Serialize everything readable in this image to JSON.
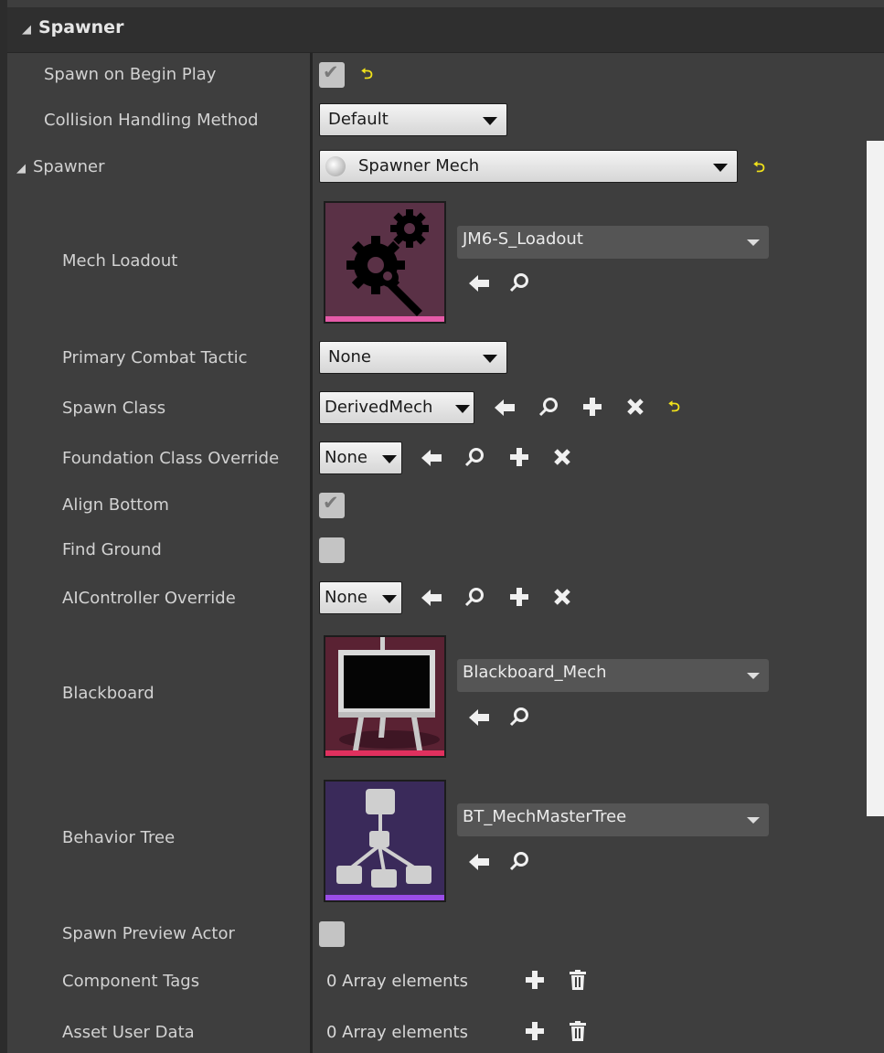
{
  "category": {
    "title": "Spawner"
  },
  "rows": {
    "spawn_on_begin_play": {
      "label": "Spawn on Begin Play",
      "checked": true
    },
    "collision_handling": {
      "label": "Collision Handling Method",
      "value": "Default"
    },
    "spawner": {
      "label": "Spawner",
      "value": "Spawner Mech"
    },
    "mech_loadout": {
      "label": "Mech Loadout",
      "asset": "JM6-S_Loadout"
    },
    "primary_combat_tactic": {
      "label": "Primary Combat Tactic",
      "value": "None"
    },
    "spawn_class": {
      "label": "Spawn Class",
      "value": "DerivedMech"
    },
    "foundation_class_override": {
      "label": "Foundation Class Override",
      "value": "None"
    },
    "align_bottom": {
      "label": "Align Bottom",
      "checked": true
    },
    "find_ground": {
      "label": "Find Ground",
      "checked": false
    },
    "aicontroller_override": {
      "label": "AIController Override",
      "value": "None"
    },
    "blackboard": {
      "label": "Blackboard",
      "asset": "Blackboard_Mech"
    },
    "behavior_tree": {
      "label": "Behavior Tree",
      "asset": "BT_MechMasterTree"
    },
    "spawn_preview_actor": {
      "label": "Spawn Preview Actor",
      "checked": false
    },
    "component_tags": {
      "label": "Component Tags",
      "value": "0 Array elements"
    },
    "asset_user_data": {
      "label": "Asset User Data",
      "value": "0 Array elements"
    }
  },
  "icons": {
    "reset": "reset-to-default-icon",
    "use_selected": "left-arrow-icon",
    "browse": "search-icon",
    "add": "plus-icon",
    "clear": "x-icon",
    "delete": "trash-icon"
  },
  "colors": {
    "reset_arrow": "#f1e21a",
    "loadout_bar": "#e55aa8",
    "blackboard_bar": "#e0305e",
    "behavior_tree_bar": "#9a4de8"
  }
}
